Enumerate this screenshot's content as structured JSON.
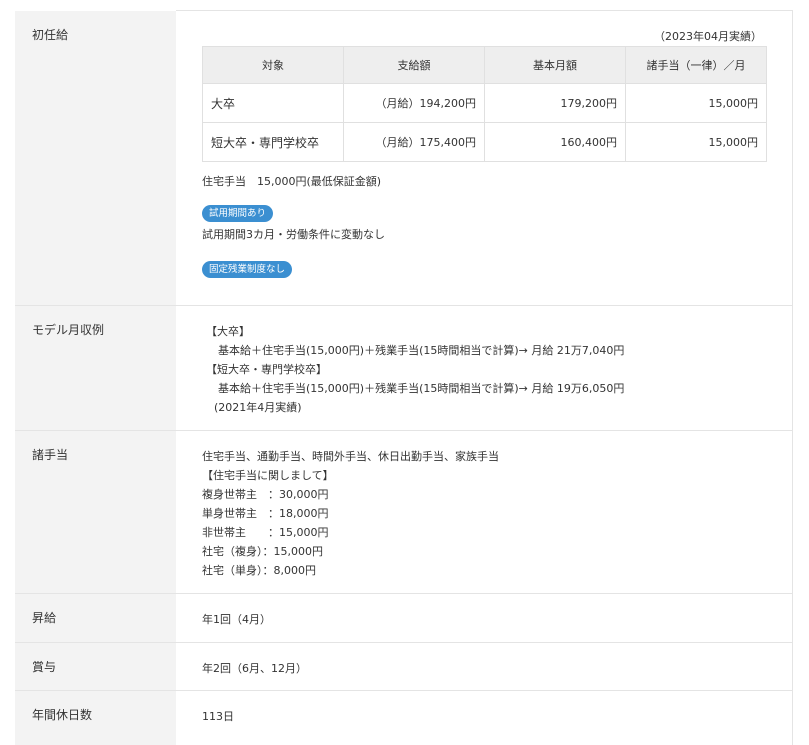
{
  "starting_salary": {
    "label": "初任給",
    "note": "（2023年04月実績）",
    "table": {
      "headers": [
        "対象",
        "支給額",
        "基本月額",
        "諸手当（一律）／月"
      ],
      "rows": [
        [
          "大卒",
          "（月給）194,200円",
          "179,200円",
          "15,000円"
        ],
        [
          "短大卒・専門学校卒",
          "（月給）175,400円",
          "160,400円",
          "15,000円"
        ]
      ]
    },
    "housing_note": "住宅手当　15,000円(最低保証金額)",
    "badge_trial": "試用期間あり",
    "trial_text": "試用期間3カ月・労働条件に変動なし",
    "badge_fixed": "固定残業制度なし"
  },
  "model_income": {
    "label": "モデル月収例",
    "lines": [
      "【大卒】",
      "基本給＋住宅手当(15,000円)＋残業手当(15時間相当で計算)→ 月給 21万7,040円",
      "【短大卒・専門学校卒】",
      "基本給＋住宅手当(15,000円)＋残業手当(15時間相当で計算)→ 月給 19万6,050円",
      "(2021年4月実績)"
    ]
  },
  "allowances": {
    "label": "諸手当",
    "lines": [
      "住宅手当、通勤手当、時間外手当、休日出勤手当、家族手当",
      "【住宅手当に関しまして】",
      "複身世帯主　：30,000円",
      "単身世帯主　：18,000円",
      "非世帯主　　：15,000円",
      "社宅（複身）：15,000円",
      "社宅（単身）：8,000円"
    ]
  },
  "raise": {
    "label": "昇給",
    "value": "年1回（4月）"
  },
  "bonus": {
    "label": "賞与",
    "value": "年2回（6月、12月）"
  },
  "holidays": {
    "label": "年間休日数",
    "value": "113日"
  },
  "colors": {
    "badge": "#3b8fd1",
    "header_bg": "#f3f3f3"
  }
}
